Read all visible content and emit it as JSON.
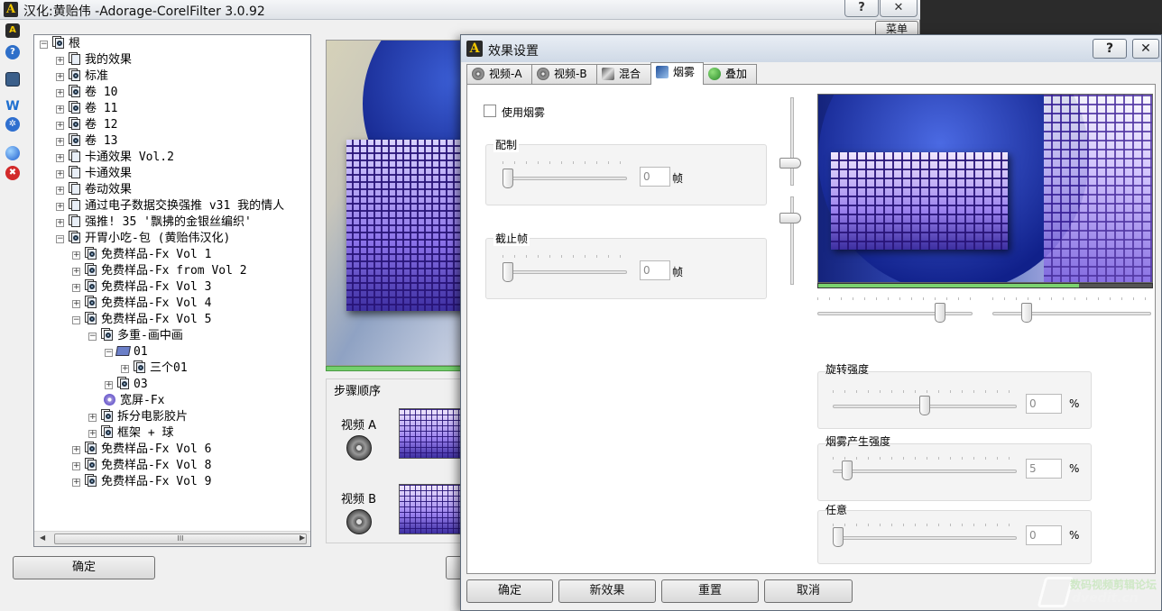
{
  "main_window": {
    "title": "汉化:黄贻伟 -Adorage-CorelFilter 3.0.92",
    "help_label": "?",
    "close_label": "✕",
    "menu_label": "菜单",
    "ok_label": "确定"
  },
  "toolbar": {
    "icons": [
      "app-icon",
      "help-icon",
      "monitor-icon",
      "blue-w-icon",
      "gear-icon",
      "globe-icon",
      "delete-icon"
    ]
  },
  "tree": {
    "root_label": "根",
    "items": [
      {
        "label": "我的效果",
        "depth": 1,
        "icon": "folder-icon",
        "expander": "+"
      },
      {
        "label": "标准",
        "depth": 1,
        "icon": "folder-search-icon",
        "expander": "+"
      },
      {
        "label": "卷 10",
        "depth": 1,
        "icon": "folder-search-icon",
        "expander": "+"
      },
      {
        "label": "卷 11",
        "depth": 1,
        "icon": "folder-search-icon",
        "expander": "+"
      },
      {
        "label": "卷 12",
        "depth": 1,
        "icon": "folder-search-icon",
        "expander": "+"
      },
      {
        "label": "卷 13",
        "depth": 1,
        "icon": "folder-search-icon",
        "expander": "+"
      },
      {
        "label": "卡通效果 Vol.2",
        "depth": 1,
        "icon": "folder-icon",
        "expander": "+"
      },
      {
        "label": "卡通效果",
        "depth": 1,
        "icon": "folder-icon",
        "expander": "+"
      },
      {
        "label": "卷动效果",
        "depth": 1,
        "icon": "folder-icon",
        "expander": "+"
      },
      {
        "label": "通过电子数据交换强推 v31 我的情人",
        "depth": 1,
        "icon": "folder-icon",
        "expander": "+"
      },
      {
        "label": "强推! 35 '飘拂的金银丝编织'",
        "depth": 1,
        "icon": "folder-icon",
        "expander": "+"
      },
      {
        "label": "开胃小吃-包 (黄贻伟汉化)",
        "depth": 1,
        "icon": "folder-search-icon",
        "expander": "−"
      },
      {
        "label": "免费样品-Fx Vol 1",
        "depth": 2,
        "icon": "folder-search-icon",
        "expander": "+"
      },
      {
        "label": "免费样品-Fx from Vol 2",
        "depth": 2,
        "icon": "folder-search-icon",
        "expander": "+"
      },
      {
        "label": "免费样品-Fx Vol 3",
        "depth": 2,
        "icon": "folder-search-icon",
        "expander": "+"
      },
      {
        "label": "免费样品-Fx Vol 4",
        "depth": 2,
        "icon": "folder-search-icon",
        "expander": "+"
      },
      {
        "label": "免费样品-Fx Vol 5",
        "depth": 2,
        "icon": "folder-search-icon",
        "expander": "−"
      },
      {
        "label": "多重-画中画",
        "depth": 3,
        "icon": "folder-search-icon",
        "expander": "−"
      },
      {
        "label": "01",
        "depth": 4,
        "icon": "folder-open-icon",
        "expander": "−"
      },
      {
        "label": "三个01",
        "depth": 5,
        "icon": "folder-search-icon",
        "expander": "+"
      },
      {
        "label": "03",
        "depth": 4,
        "icon": "folder-search-icon",
        "expander": "+"
      },
      {
        "label": "宽屏-Fx",
        "depth": 3,
        "icon": "disc-icon",
        "expander": ""
      },
      {
        "label": "拆分电影胶片",
        "depth": 3,
        "icon": "folder-search-icon",
        "expander": "+"
      },
      {
        "label": "框架 + 球",
        "depth": 3,
        "icon": "folder-search-icon",
        "expander": "+"
      },
      {
        "label": "免费样品-Fx Vol 6",
        "depth": 2,
        "icon": "folder-search-icon",
        "expander": "+"
      },
      {
        "label": "免费样品-Fx Vol 8",
        "depth": 2,
        "icon": "folder-search-icon",
        "expander": "+"
      },
      {
        "label": "免费样品-Fx Vol 9",
        "depth": 2,
        "icon": "folder-search-icon",
        "expander": "+"
      }
    ],
    "scroll_grip": "III"
  },
  "steps": {
    "title": "步骤顺序",
    "video_a": "视频 A",
    "video_b": "视频 B"
  },
  "dialog": {
    "title": "效果设置",
    "help_label": "?",
    "close_label": "✕",
    "tabs": [
      {
        "label": "视频-A",
        "icon": "film-icon",
        "active": false
      },
      {
        "label": "视频-B",
        "icon": "film-icon",
        "active": false
      },
      {
        "label": "混合",
        "icon": "mix-icon",
        "active": false
      },
      {
        "label": "烟雾",
        "icon": "smoke-icon",
        "active": true
      },
      {
        "label": "叠加",
        "icon": "overlay-icon",
        "active": false
      }
    ],
    "use_smoke_label": "使用烟雾",
    "use_smoke_checked": false,
    "config_group": {
      "label": "配制",
      "value": "0",
      "unit": "帧",
      "level": 0
    },
    "cutoff_group": {
      "label": "截止帧",
      "value": "0",
      "unit": "帧",
      "level": 0
    },
    "rotation_group": {
      "label": "旋转强度",
      "value": "0",
      "unit": "%",
      "level": 0.5
    },
    "smoke_strength_group": {
      "label": "烟雾产生强度",
      "value": "5",
      "unit": "%",
      "level": 0.05
    },
    "random_group": {
      "label": "任意",
      "value": "0",
      "unit": "%",
      "level": 0
    },
    "progress_fraction": 0.78,
    "buttons": {
      "ok": "确定",
      "new_effect": "新效果",
      "reset": "重置",
      "cancel": "取消"
    }
  },
  "watermark": {
    "line1": "数码视频剪辑论坛",
    "line2": "dvedit.cn"
  }
}
